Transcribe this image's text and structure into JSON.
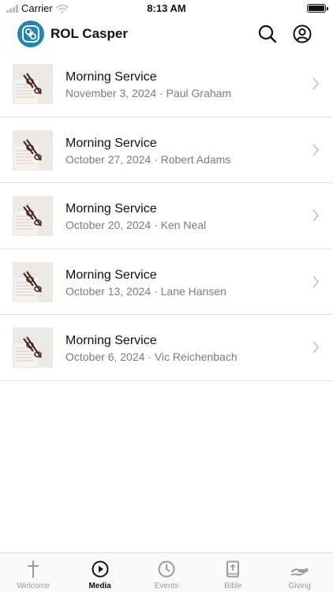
{
  "status_bar": {
    "carrier": "Carrier",
    "time": "8:13 AM"
  },
  "header": {
    "title": "ROL Casper"
  },
  "icons": {
    "logo": "app-logo-icon",
    "search": "search-icon",
    "profile": "profile-icon",
    "chevron": "chevron-right-icon"
  },
  "colors": {
    "logo_bg": "#2a86a8",
    "secondary_text": "#7b7b80",
    "divider": "#e3e3e6"
  },
  "media": {
    "items": [
      {
        "title": "Morning Service",
        "subtitle": "November 3, 2024 · Paul Graham"
      },
      {
        "title": "Morning Service",
        "subtitle": "October 27, 2024 · Robert Adams"
      },
      {
        "title": "Morning Service",
        "subtitle": "October 20, 2024 · Ken Neal"
      },
      {
        "title": "Morning Service",
        "subtitle": "October 13, 2024 · Lane Hansen"
      },
      {
        "title": "Morning Service",
        "subtitle": "October 6, 2024 · Vic Reichenbach"
      }
    ]
  },
  "tabs": [
    {
      "label": "Welcome",
      "icon": "cross-icon",
      "active": false
    },
    {
      "label": "Media",
      "icon": "play-icon",
      "active": true
    },
    {
      "label": "Events",
      "icon": "clock-icon",
      "active": false
    },
    {
      "label": "Bible",
      "icon": "bible-icon",
      "active": false
    },
    {
      "label": "Giving",
      "icon": "giving-hand-icon",
      "active": false
    }
  ]
}
